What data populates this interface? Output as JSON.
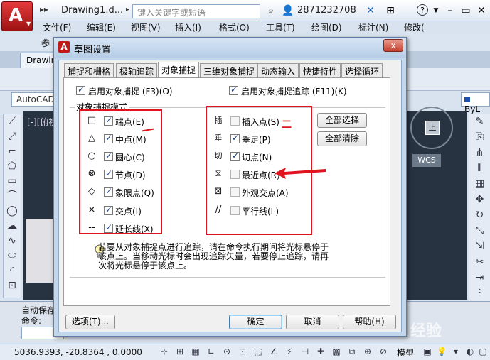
{
  "app": {
    "title": "Drawing1.d...",
    "search_placeholder": "键入关键字或短语",
    "user_id": "2871232708",
    "doc_tab": "Drawin",
    "workspace": "AutoCAD",
    "layer": "ByL",
    "viewport_label": "[-][俯视",
    "wcs": "WCS",
    "viewcube_face": "上",
    "menu": [
      "文件(F)",
      "编辑(E)",
      "视图(V)",
      "插入(I)",
      "格式(O)",
      "工具(T)",
      "绘图(D)",
      "标注(N)",
      "修改("
    ],
    "menu_row2_left": "参",
    "cmd_autosave": "自动保存",
    "cmd_prompt": "命令:",
    "coords": "5036.9393, -20.8364 , 0.0000",
    "model": "模型",
    "watermark": "Bai 经验"
  },
  "dialog": {
    "title": "草图设置",
    "close_label": "x",
    "tabs": [
      "捕捉和栅格",
      "极轴追踪",
      "对象捕捉",
      "三维对象捕捉",
      "动态输入",
      "快捷特性",
      "选择循环"
    ],
    "active_tab": "对象捕捉",
    "enable_osnap": "启用对象捕捉 (F3)(O)",
    "enable_osnap_tracking": "启用对象捕捉追踪 (F11)(K)",
    "group_label": "对象捕捉模式",
    "left_modes": [
      {
        "symbol": "□",
        "label": "端点(E)",
        "checked": true
      },
      {
        "symbol": "△",
        "label": "中点(M)",
        "checked": true
      },
      {
        "symbol": "○",
        "label": "圆心(C)",
        "checked": true
      },
      {
        "symbol": "⊗",
        "label": "节点(D)",
        "checked": true
      },
      {
        "symbol": "◇",
        "label": "象限点(Q)",
        "checked": true
      },
      {
        "symbol": "×",
        "label": "交点(I)",
        "checked": true
      },
      {
        "symbol": "--",
        "label": "延长线(X)",
        "checked": true
      }
    ],
    "right_modes": [
      {
        "symbol": "插",
        "label": "插入点(S)",
        "checked": false
      },
      {
        "symbol": "垂",
        "label": "垂足(P)",
        "checked": true
      },
      {
        "symbol": "切",
        "label": "切点(N)",
        "checked": true
      },
      {
        "symbol": "⧖",
        "label": "最近点(R)",
        "checked": false
      },
      {
        "symbol": "⊠",
        "label": "外观交点(A)",
        "checked": false
      },
      {
        "symbol": "//",
        "label": "平行线(L)",
        "checked": false
      }
    ],
    "select_all": "全部选择",
    "clear_all": "全部清除",
    "hint_lines": [
      "若要从对象捕捉点进行追踪，请在命令执行期间将光标悬停于",
      "该点上。当移动光标时会出现追踪矢量，若要停止追踪，请再",
      "次将光标悬停于该点上。"
    ],
    "options_btn": "选项(T)...",
    "ok_btn": "确定",
    "cancel_btn": "取消",
    "help_btn": "帮助(H)"
  },
  "colors": {
    "annotation_red": "#e0141e",
    "autocad_red": "#c21a1a"
  }
}
